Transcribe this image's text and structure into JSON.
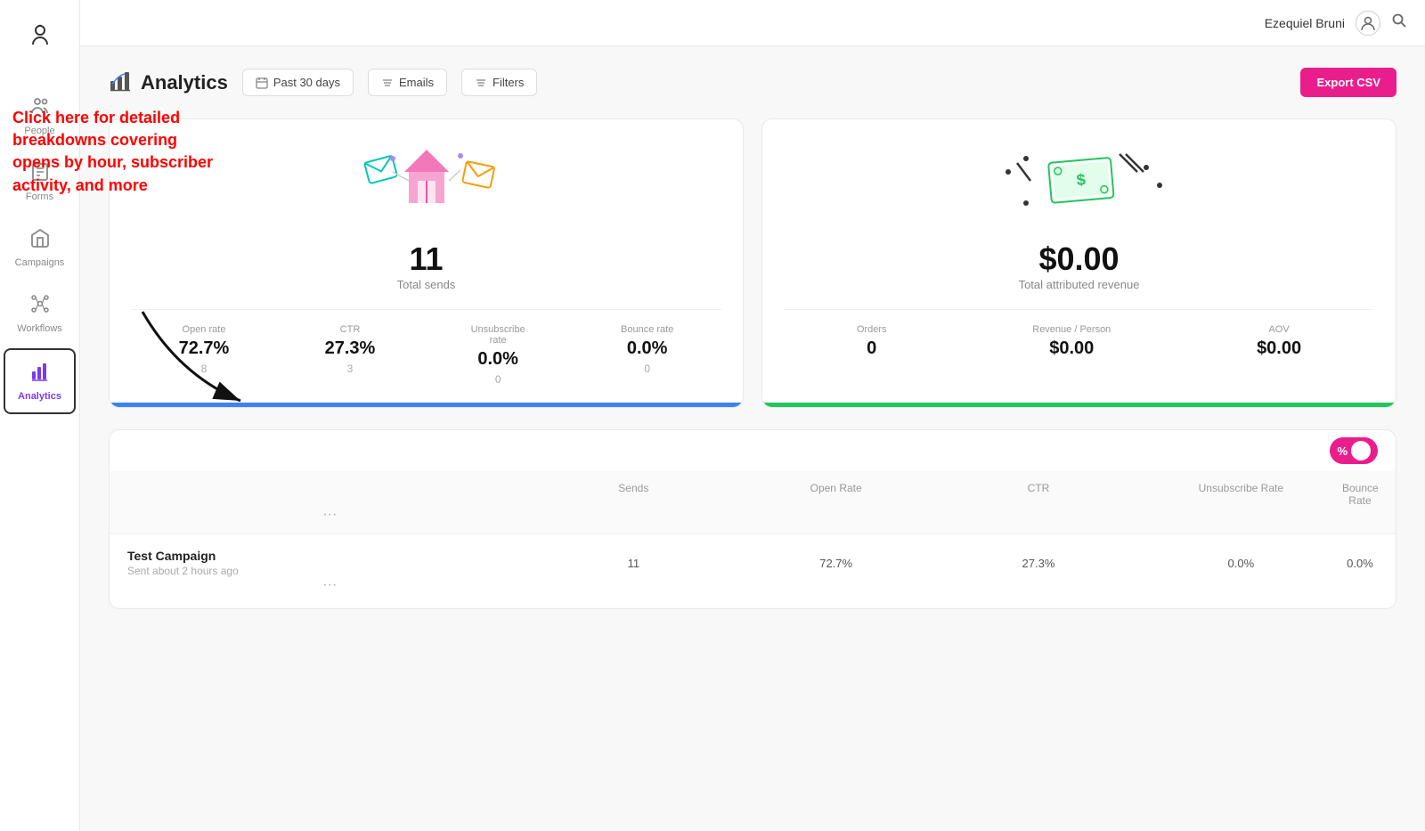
{
  "topbar": {
    "user_name": "Ezequiel Bruni",
    "avatar_symbol": "👤"
  },
  "sidebar": {
    "logo": "☺",
    "items": [
      {
        "id": "people",
        "label": "People",
        "icon": "👥"
      },
      {
        "id": "forms",
        "label": "Forms",
        "icon": "📋"
      },
      {
        "id": "campaigns",
        "label": "Campaigns",
        "icon": "📢"
      },
      {
        "id": "workflows",
        "label": "Workflows",
        "icon": "⚙"
      },
      {
        "id": "analytics",
        "label": "Analytics",
        "icon": "📊"
      }
    ]
  },
  "page": {
    "title": "Analytics",
    "filters": {
      "date": "Past 30 days",
      "emails": "Emails",
      "filters": "Filters"
    },
    "export_btn": "Export CSV"
  },
  "sends_card": {
    "main_value": "11",
    "main_label": "Total sends",
    "stats": [
      {
        "label": "Open rate",
        "value": "72.7%",
        "sub": "8"
      },
      {
        "label": "CTR",
        "value": "27.3%",
        "sub": "3"
      },
      {
        "label": "Unsubscribe rate",
        "value": "0.0%",
        "sub": "0"
      },
      {
        "label": "Bounce rate",
        "value": "0.0%",
        "sub": "0"
      }
    ]
  },
  "revenue_card": {
    "main_value": "$0.00",
    "main_label": "Total attributed revenue",
    "stats": [
      {
        "label": "Orders",
        "value": "0"
      },
      {
        "label": "Revenue / Person",
        "value": "$0.00"
      },
      {
        "label": "AOV",
        "value": "$0.00"
      }
    ]
  },
  "table": {
    "toggle_label": "%",
    "headers": [
      "",
      "Sends",
      "Open Rate",
      "CTR",
      "Unsubscribe Rate",
      "Bounce Rate",
      ""
    ],
    "rows": [
      {
        "name": "Test Campaign",
        "sub": "Sent about 2 hours ago",
        "sends": "11",
        "open_rate": "72.7%",
        "ctr": "27.3%",
        "unsub_rate": "0.0%",
        "bounce_rate": "0.0%"
      }
    ]
  },
  "annotation": {
    "text": "Click here for detailed breakdowns covering opens by hour, subscriber activity, and more"
  }
}
